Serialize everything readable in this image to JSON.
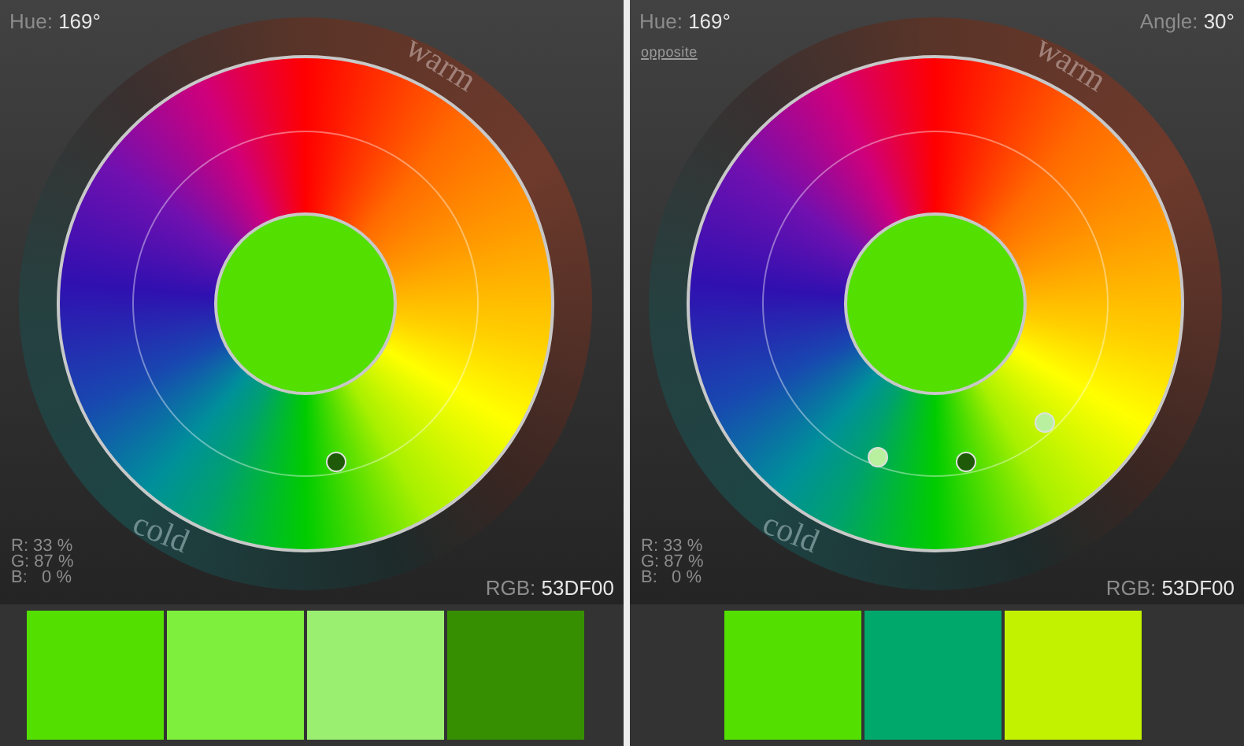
{
  "panels": [
    {
      "hue_label": "Hue:",
      "hue_value": "169°",
      "warm": "warm",
      "cold": "cold",
      "rgb_percent": [
        "R: 33 %",
        "G: 87 %",
        "B:   0 %"
      ],
      "rgb_label": "RGB:",
      "rgb_value": "53DF00",
      "markers": [
        {
          "selected": true
        }
      ],
      "swatches": [
        {
          "color": "#53df00"
        },
        {
          "color": "#7eef3c"
        },
        {
          "color": "#9bef70"
        },
        {
          "color": "#358f00"
        }
      ]
    },
    {
      "hue_label": "Hue:",
      "hue_value": "169°",
      "angle_label": "Angle:",
      "angle_value": "30°",
      "link": "opposite",
      "warm": "warm",
      "cold": "cold",
      "rgb_percent": [
        "R: 33 %",
        "G: 87 %",
        "B:   0 %"
      ],
      "rgb_label": "RGB:",
      "rgb_value": "53DF00",
      "markers": [
        {
          "selected": false
        },
        {
          "selected": true
        },
        {
          "selected": false
        }
      ],
      "swatches": [
        {
          "color": "#53df00"
        },
        {
          "color": "#00a86b"
        },
        {
          "color": "#c2f200"
        }
      ]
    }
  ]
}
